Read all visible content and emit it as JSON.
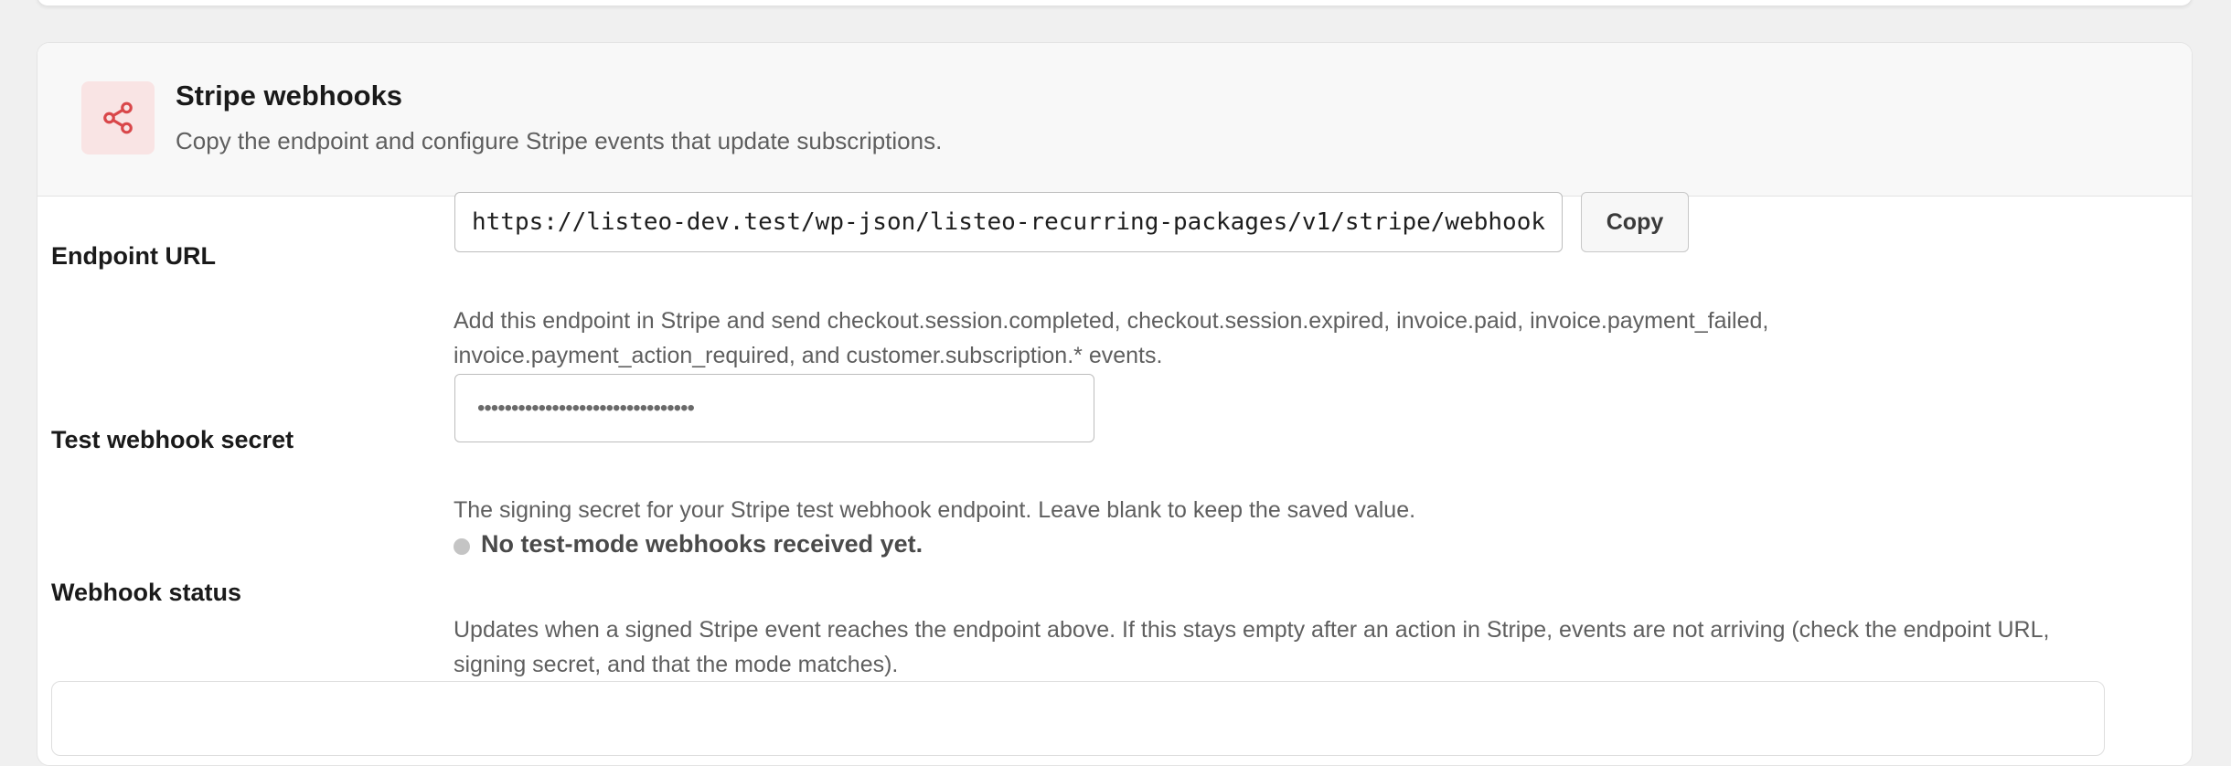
{
  "section": {
    "title": "Stripe webhooks",
    "description": "Copy the endpoint and configure Stripe events that update subscriptions.",
    "icon": "share-icon",
    "icon_color": "#d9474a",
    "icon_bg": "#f9e4e4"
  },
  "endpoint": {
    "label": "Endpoint URL",
    "value": "https://listeo-dev.test/wp-json/listeo-recurring-packages/v1/stripe/webhook",
    "copy_label": "Copy",
    "help_line1": "Add this endpoint in Stripe and send checkout.session.completed, checkout.session.expired, invoice.paid, invoice.payment_failed,",
    "help_line2": "invoice.payment_action_required, and customer.subscription.* events."
  },
  "secret": {
    "label": "Test webhook secret",
    "masked_value": "••••••••••••••••••••••••••••••••",
    "help": "The signing secret for your Stripe test webhook endpoint. Leave blank to keep the saved value."
  },
  "status": {
    "label": "Webhook status",
    "text": "No test-mode webhooks received yet.",
    "dot_color": "#c4c4c4",
    "help_line1": "Updates when a signed Stripe event reaches the endpoint above. If this stays empty after an action in Stripe, events are not arriving (check the endpoint URL,",
    "help_line2": "signing secret, and that the mode matches)."
  }
}
